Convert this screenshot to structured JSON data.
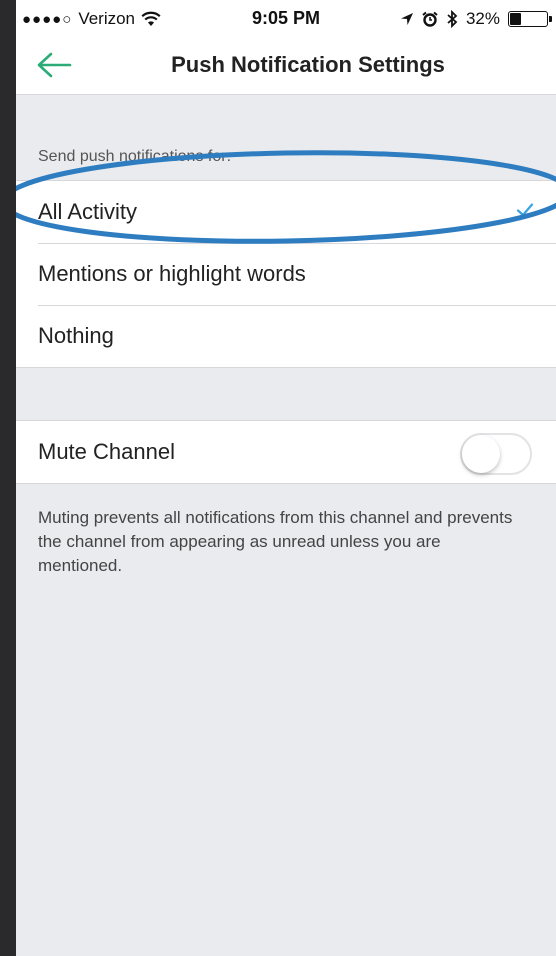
{
  "status_bar": {
    "signal": "●●●●○",
    "carrier": "Verizon",
    "time": "9:05 PM",
    "battery_percent": "32%",
    "battery_level": 0.32,
    "icons": [
      "wifi-icon",
      "location-icon",
      "alarm-icon",
      "bluetooth-icon",
      "battery-icon"
    ]
  },
  "nav": {
    "title": "Push Notification Settings",
    "back_icon": "back-arrow-icon"
  },
  "notifications": {
    "header": "Send push notifications for:",
    "options": [
      {
        "label": "All Activity",
        "selected": true
      },
      {
        "label": "Mentions or highlight words",
        "selected": false
      },
      {
        "label": "Nothing",
        "selected": false
      }
    ]
  },
  "mute": {
    "label": "Mute Channel",
    "enabled": false,
    "help_text": "Muting prevents all notifications from this channel and prevents the channel from appearing as unread unless you are mentioned."
  },
  "colors": {
    "accent": "#3aa3e3",
    "back_arrow": "#2bac76",
    "annotation": "#2f7dc1"
  }
}
